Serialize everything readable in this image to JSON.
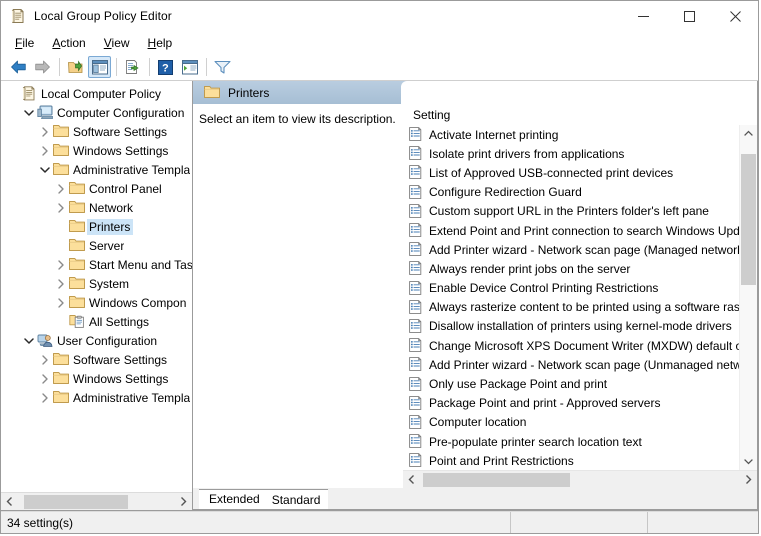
{
  "window": {
    "title": "Local Group Policy Editor",
    "icon": "policy-document-icon",
    "minimize_label": "Minimize",
    "maximize_label": "Maximize",
    "close_label": "Close"
  },
  "menubar": {
    "items": [
      {
        "label": "File",
        "accel": "F"
      },
      {
        "label": "Action",
        "accel": "A"
      },
      {
        "label": "View",
        "accel": "V"
      },
      {
        "label": "Help",
        "accel": "H"
      }
    ]
  },
  "toolbar": {
    "buttons": [
      {
        "name": "back-button",
        "icon": "back-arrow-icon",
        "label": "Back"
      },
      {
        "name": "forward-button",
        "icon": "forward-arrow-icon",
        "label": "Forward"
      },
      {
        "name": "up-one-level-button",
        "icon": "up-folder-icon",
        "label": "Up One Level"
      },
      {
        "name": "show-hide-console-tree-button",
        "icon": "console-tree-icon",
        "label": "Show/Hide Console Tree",
        "active": true
      },
      {
        "name": "export-list-button",
        "icon": "export-list-icon",
        "label": "Export List"
      },
      {
        "name": "help-button",
        "icon": "help-question-icon",
        "label": "Help"
      },
      {
        "name": "show-hide-action-pane-button",
        "icon": "action-pane-icon",
        "label": "Show/Hide Action Pane"
      },
      {
        "name": "filter-button",
        "icon": "filter-funnel-icon",
        "label": "Filter"
      }
    ]
  },
  "tree": {
    "nodes": [
      {
        "label": "Local Computer Policy",
        "indent": 0,
        "twisty": "none",
        "icon": "policy-document-icon",
        "selected": false
      },
      {
        "label": "Computer Configuration",
        "indent": 1,
        "twisty": "expanded",
        "icon": "computer-icon",
        "selected": false
      },
      {
        "label": "Software Settings",
        "indent": 2,
        "twisty": "collapsed",
        "icon": "folder-icon",
        "selected": false
      },
      {
        "label": "Windows Settings",
        "indent": 2,
        "twisty": "collapsed",
        "icon": "folder-icon",
        "selected": false
      },
      {
        "label": "Administrative Templa",
        "indent": 2,
        "twisty": "expanded",
        "icon": "folder-icon",
        "selected": false
      },
      {
        "label": "Control Panel",
        "indent": 3,
        "twisty": "collapsed",
        "icon": "folder-icon",
        "selected": false
      },
      {
        "label": "Network",
        "indent": 3,
        "twisty": "collapsed",
        "icon": "folder-icon",
        "selected": false
      },
      {
        "label": "Printers",
        "indent": 3,
        "twisty": "none",
        "icon": "folder-icon",
        "selected": true
      },
      {
        "label": "Server",
        "indent": 3,
        "twisty": "none",
        "icon": "folder-icon",
        "selected": false
      },
      {
        "label": "Start Menu and Tas",
        "indent": 3,
        "twisty": "collapsed",
        "icon": "folder-icon",
        "selected": false
      },
      {
        "label": "System",
        "indent": 3,
        "twisty": "collapsed",
        "icon": "folder-icon",
        "selected": false
      },
      {
        "label": "Windows Compon",
        "indent": 3,
        "twisty": "collapsed",
        "icon": "folder-icon",
        "selected": false
      },
      {
        "label": "All Settings",
        "indent": 3,
        "twisty": "none",
        "icon": "all-settings-icon",
        "selected": false
      },
      {
        "label": "User Configuration",
        "indent": 1,
        "twisty": "expanded",
        "icon": "user-icon",
        "selected": false
      },
      {
        "label": "Software Settings",
        "indent": 2,
        "twisty": "collapsed",
        "icon": "folder-icon",
        "selected": false
      },
      {
        "label": "Windows Settings",
        "indent": 2,
        "twisty": "collapsed",
        "icon": "folder-icon",
        "selected": false
      },
      {
        "label": "Administrative Templa",
        "indent": 2,
        "twisty": "collapsed",
        "icon": "folder-icon",
        "selected": false
      }
    ]
  },
  "pane": {
    "header_title": "Printers",
    "header_icon": "folder-icon",
    "description_text": "Select an item to view its description.",
    "column_header": "Setting"
  },
  "settings": {
    "items": [
      "Activate Internet printing",
      "Isolate print drivers from applications",
      "List of Approved USB-connected print devices",
      "Configure Redirection Guard",
      "Custom support URL in the Printers folder's left pane",
      "Extend Point and Print connection to search Windows Upd",
      "Add Printer wizard - Network scan page (Managed network",
      "Always render print jobs on the server",
      "Enable Device Control Printing Restrictions",
      "Always rasterize content to be printed using a software rast",
      "Disallow installation of printers using kernel-mode drivers",
      "Change Microsoft XPS Document Writer (MXDW) default o",
      "Add Printer wizard - Network scan page (Unmanaged netw",
      "Only use Package Point and print",
      "Package Point and print - Approved servers",
      "Computer location",
      "Pre-populate printer search location text",
      "Point and Print Restrictions"
    ]
  },
  "tabs": [
    {
      "label": "Extended",
      "selected": true
    },
    {
      "label": "Standard",
      "selected": false
    }
  ],
  "statusbar": {
    "count_text": "34 setting(s)",
    "cell2": "",
    "cell3": ""
  },
  "scrollbars": {
    "tree_h_thumb_left_pct": 4,
    "tree_h_thumb_width_pct": 66,
    "list_v_thumb_top_pct": 4,
    "list_v_thumb_height_pct": 42,
    "list_h_thumb_left_pct": 1,
    "list_h_thumb_width_pct": 46
  },
  "colors": {
    "header_gradient_top": "#b9cde0",
    "header_gradient_bottom": "#a6bed4",
    "selection": "#cce4f7",
    "folder": "#fcdf9b",
    "scrollbar_thumb": "#cdcdcd",
    "window_bg": "#f0f0f0"
  }
}
